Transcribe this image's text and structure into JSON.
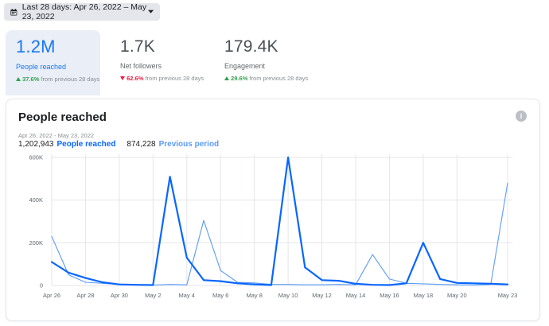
{
  "date_range_button": {
    "label": "Last 28 days: Apr 26, 2022 – May 23, 2022",
    "icon": "calendar-icon"
  },
  "metrics": [
    {
      "value": "1.2M",
      "label": "People reached",
      "change": "37.6%",
      "direction": "up",
      "suffix": "from previous 28 days",
      "active": true
    },
    {
      "value": "1.7K",
      "label": "Net followers",
      "change": "62.6%",
      "direction": "down",
      "suffix": "from previous 28 days",
      "active": false
    },
    {
      "value": "179.4K",
      "label": "Engagement",
      "change": "29.6%",
      "direction": "up",
      "suffix": "from previous 28 days",
      "active": false
    }
  ],
  "card": {
    "title": "People reached",
    "range": "Apr 26, 2022 - May 23, 2022",
    "current_total": "1,202,943",
    "current_label": "People reached",
    "previous_total": "874,228",
    "previous_label": "Previous period"
  },
  "colors": {
    "current": "#0866ff",
    "previous": "#5b9bf5",
    "grid": "#e4e6eb"
  },
  "chart_data": {
    "type": "line",
    "ylim": [
      0,
      600000
    ],
    "yticks": [
      0,
      200000,
      400000,
      600000
    ],
    "ytick_labels": [
      "0",
      "200K",
      "400K",
      "600K"
    ],
    "x": [
      "Apr 26",
      "Apr 27",
      "Apr 28",
      "Apr 29",
      "Apr 30",
      "May 1",
      "May 2",
      "May 3",
      "May 4",
      "May 5",
      "May 6",
      "May 7",
      "May 8",
      "May 9",
      "May 10",
      "May 11",
      "May 12",
      "May 13",
      "May 14",
      "May 15",
      "May 16",
      "May 17",
      "May 18",
      "May 19",
      "May 20",
      "May 21",
      "May 22",
      "May 23"
    ],
    "xtick_labels": [
      "Apr 26",
      "Apr 28",
      "Apr 30",
      "May 2",
      "May 4",
      "May 6",
      "May 8",
      "May 10",
      "May 12",
      "May 14",
      "May 16",
      "May 18",
      "May 20",
      "May 23"
    ],
    "series": [
      {
        "name": "People reached",
        "values": [
          110000,
          60000,
          35000,
          15000,
          5000,
          3000,
          2000,
          510000,
          130000,
          25000,
          20000,
          10000,
          5000,
          2000,
          600000,
          85000,
          25000,
          22000,
          8000,
          3000,
          2000,
          10000,
          200000,
          30000,
          12000,
          10000,
          8000,
          5000
        ]
      },
      {
        "name": "Previous period",
        "values": [
          230000,
          50000,
          15000,
          10000,
          5000,
          3000,
          2000,
          5000,
          3000,
          305000,
          70000,
          15000,
          12000,
          5000,
          5000,
          3000,
          3000,
          5000,
          3000,
          145000,
          30000,
          10000,
          8000,
          5000,
          3000,
          2000,
          5000,
          480000
        ]
      }
    ]
  }
}
